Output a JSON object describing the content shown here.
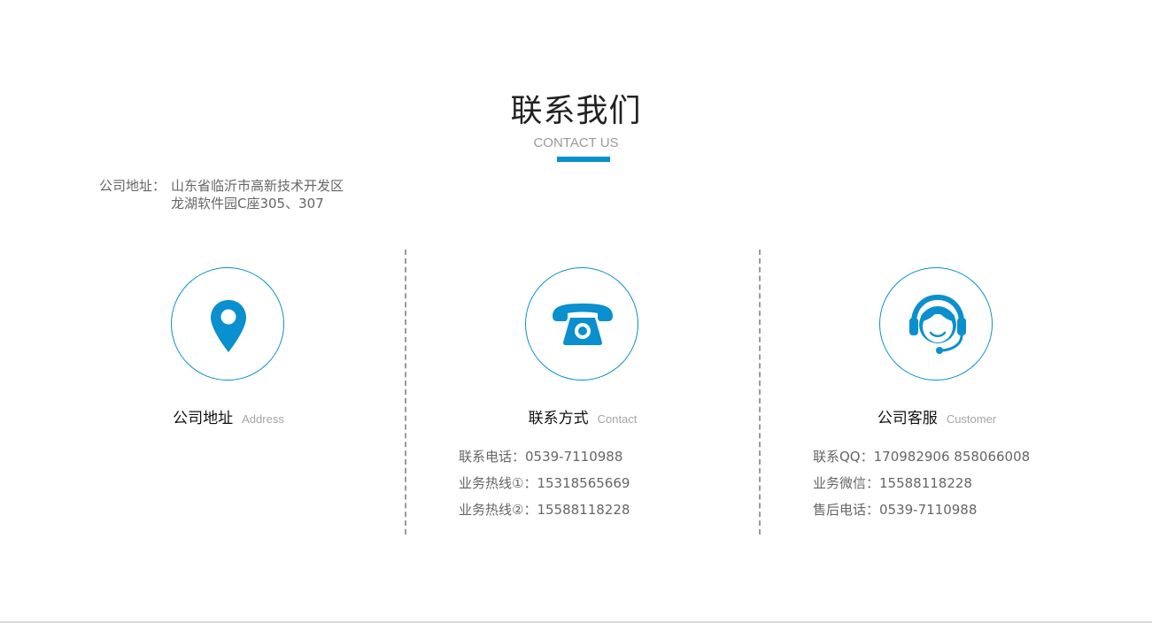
{
  "section": {
    "title": "联系我们",
    "subtitle": "CONTACT US"
  },
  "colors": {
    "accent": "#0a8fcf",
    "divider": "#9a9a9a"
  },
  "columns": [
    {
      "icon": "location-pin-icon",
      "title_zh": "公司地址",
      "title_en": "Address",
      "address_label": "公司地址：",
      "address_line1": "山东省临沂市高新技术开发区",
      "address_line2": "龙湖软件园C座305、307"
    },
    {
      "icon": "telephone-icon",
      "title_zh": "联系方式",
      "title_en": "Contact",
      "lines": [
        "联系电话：0539-7110988",
        "业务热线①：15318565669",
        "业务热线②：15588118228"
      ]
    },
    {
      "icon": "customer-service-headset-icon",
      "title_zh": "公司客服",
      "title_en": "Customer",
      "lines": [
        "联系QQ：170982906 858066008",
        "业务微信：15588118228",
        "售后电话：0539-7110988"
      ]
    }
  ]
}
